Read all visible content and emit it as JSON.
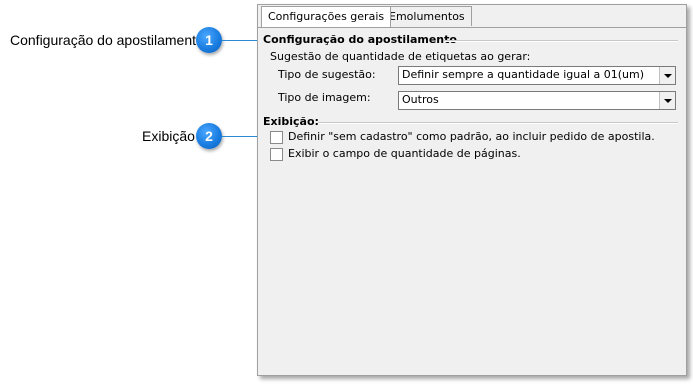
{
  "callouts": [
    {
      "label": "Configuração do apostilamento",
      "number": "1"
    },
    {
      "label": "Exibição",
      "number": "2"
    }
  ],
  "tabs": [
    {
      "label": "Configurações gerais",
      "active": true
    },
    {
      "label": "Emolumentos",
      "active": false
    }
  ],
  "section_apostilamento": {
    "title": "Configuração do apostilamento",
    "subtitle": "Sugestão de quantidade de etiquetas ao gerar:",
    "tipo_sugestao_label": "Tipo de sugestão:",
    "tipo_sugestao_value": "Definir sempre a quantidade igual a 01(um)",
    "tipo_imagem_label": "Tipo de imagem:",
    "tipo_imagem_value": "Outros"
  },
  "section_exibicao": {
    "title": "Exibição:",
    "options": [
      {
        "label": "Definir \"sem cadastro\" como padrão, ao incluir pedido de apostila.",
        "checked": false
      },
      {
        "label": "Exibir o campo de quantidade de páginas.",
        "checked": false
      }
    ]
  },
  "colors": {
    "accent": "#1a7de0",
    "panel": "#f0f0f0"
  }
}
